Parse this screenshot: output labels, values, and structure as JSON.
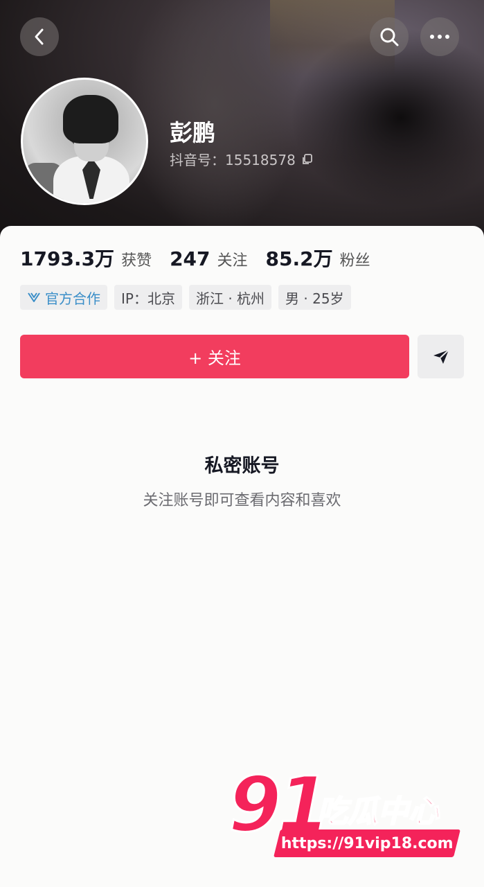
{
  "profile": {
    "name": "彭鹏",
    "uid_label": "抖音号：15518578"
  },
  "stats": [
    {
      "value": "1793.3万",
      "label": "获赞"
    },
    {
      "value": "247",
      "label": "关注"
    },
    {
      "value": "85.2万",
      "label": "粉丝"
    }
  ],
  "tags": {
    "official": "官方合作",
    "ip": "IP：北京",
    "location": "浙江 · 杭州",
    "gender_age": "男 · 25岁"
  },
  "actions": {
    "follow_label": "+ 关注"
  },
  "private": {
    "title": "私密账号",
    "subtitle": "关注账号即可查看内容和喜欢"
  },
  "watermark": {
    "number": "91",
    "text": "吃瓜中心",
    "url": "https://91vip18.com"
  },
  "colors": {
    "accent": "#f23d5e",
    "official_tag": "#3a8ec8"
  },
  "icons": [
    "back-icon",
    "search-icon",
    "more-icon",
    "copy-icon",
    "official-badge-icon",
    "send-icon"
  ]
}
